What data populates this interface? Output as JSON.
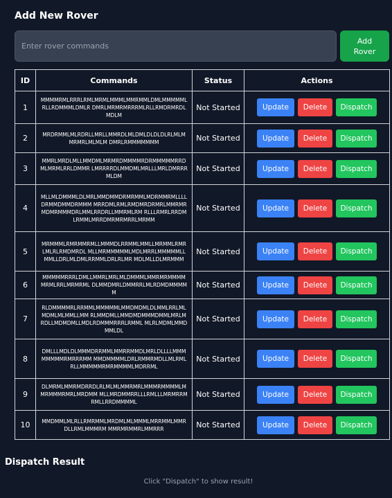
{
  "add_rover": {
    "title": "Add New Rover",
    "input_placeholder": "Enter rover commands",
    "input_value": "",
    "add_button_label": "Add Rover"
  },
  "table": {
    "headers": {
      "id": "ID",
      "commands": "Commands",
      "status": "Status",
      "actions": "Actions"
    },
    "rows": [
      {
        "id": "1",
        "commands": "MMMMRMLRRRLRMLMRMLMMMLMMRMMLDMLMMMMMLRLLRDMMMLDMLR DMRLMRMRMRRRMLRLLRMDRMRDLMDLM",
        "status": "Not Started",
        "update_label": "Update",
        "delete_label": "Delete",
        "dispatch_label": "Dispatch"
      },
      {
        "id": "2",
        "commands": "MRDRMMLMLRDRLLMRLLMMRDLMLDMLDLDLDLRLMLMMRMRLMLMLM DMRLRMMMMMMM",
        "status": "Not Started",
        "update_label": "Update",
        "delete_label": "Delete",
        "dispatch_label": "Dispatch"
      },
      {
        "id": "3",
        "commands": "MMRLMRDLMLLMMDMLMRMRDMMMMRDRMMMMMRRDMLMRMLRRLDMMR LMRRRRDLMMDMLMRLLLMRLDMRRRMLDM",
        "status": "Not Started",
        "update_label": "Update",
        "delete_label": "Delete",
        "dispatch_label": "Dispatch"
      },
      {
        "id": "4",
        "commands": "MLLMLDMMMLDLMRLMMDMMDRMRMMLMDRMMRMLLLLDRMMDMMDRMMM MRRDMLRMLRMDMRDRMRLMMRMRMDMRMMMDRLMMLRRDRLLMMRMLRM RLLLRMRLRRDMLRMMLMRRDMRMRMRRLMRMM",
        "status": "Not Started",
        "update_label": "Update",
        "delete_label": "Delete",
        "dispatch_label": "Dispatch"
      },
      {
        "id": "5",
        "commands": "MRMMMLRMRMMRMLLMMMDLRRMMLMMLLMRMMLRMRLMLRLRMDMRDL MLLMRMMMMMLMDLMRRLMMMMMLLMMLLDRLMLDMLRRMMLDRLRLMR MDLMLLDLMRMMM",
        "status": "Not Started",
        "update_label": "Update",
        "delete_label": "Delete",
        "dispatch_label": "Dispatch"
      },
      {
        "id": "6",
        "commands": "MMMMMRRRLDMLLMMRLMRLMLDMMMLMMRMRMMMMMRMLRRLMRMRML DLMMDMRLDMMRRLMLRDMDMMMMM",
        "status": "Not Started",
        "update_label": "Update",
        "delete_label": "Delete",
        "dispatch_label": "Dispatch"
      },
      {
        "id": "7",
        "commands": "RLDMMMMRLRRMMLMMMMMLMMDMDMLDLMMLRRLMLMDMLMLMMLLMM RLMMDMLLMMDMDMMMDMMLMRLMRDLLMDMDMLLMDLRDMMMRRRLRMML MLRLMDMLMMDMMLDL",
        "status": "Not Started",
        "update_label": "Update",
        "delete_label": "Delete",
        "dispatch_label": "Dispatch"
      },
      {
        "id": "8",
        "commands": "DMLLLMDLDLMMMDRRMMLMMRRMMDLMRLDLLLLMMMMMMMMRMRRRMM MMDMMMMLDRLRMMRMDLLMLRMLRLLMMMMMRMRMMMMLMDRRML",
        "status": "Not Started",
        "update_label": "Update",
        "delete_label": "Delete",
        "dispatch_label": "Dispatch"
      },
      {
        "id": "9",
        "commands": "DLMRMLMMRMDRRDLRLMLMLMMRMRLMMMRMMMMLMMRMMMRMRLMRDMM MLLMRDMMRRLLLRMLLLMRMRRMRMLLRRDMMMML",
        "status": "Not Started",
        "update_label": "Update",
        "delete_label": "Delete",
        "dispatch_label": "Dispatch"
      },
      {
        "id": "10",
        "commands": "MMDMMLMLRLLRMRMMLMRDMLMLMMMLMRRMMLMMRDLLRMLMMMRM MMRMRMMRLMMRRR",
        "status": "Not Started",
        "update_label": "Update",
        "delete_label": "Delete",
        "dispatch_label": "Dispatch"
      }
    ]
  },
  "dispatch_result": {
    "title": "Dispatch Result",
    "hint": "Click \"Dispatch\" to show result!"
  },
  "colors": {
    "background": "#111827",
    "input_background": "#374151",
    "add_button": "#16a34a",
    "update_button": "#3b82f6",
    "delete_button": "#ef4444",
    "dispatch_button": "#22c55e",
    "table_border": "#d1d5db",
    "hint_text": "#9ca3af"
  }
}
